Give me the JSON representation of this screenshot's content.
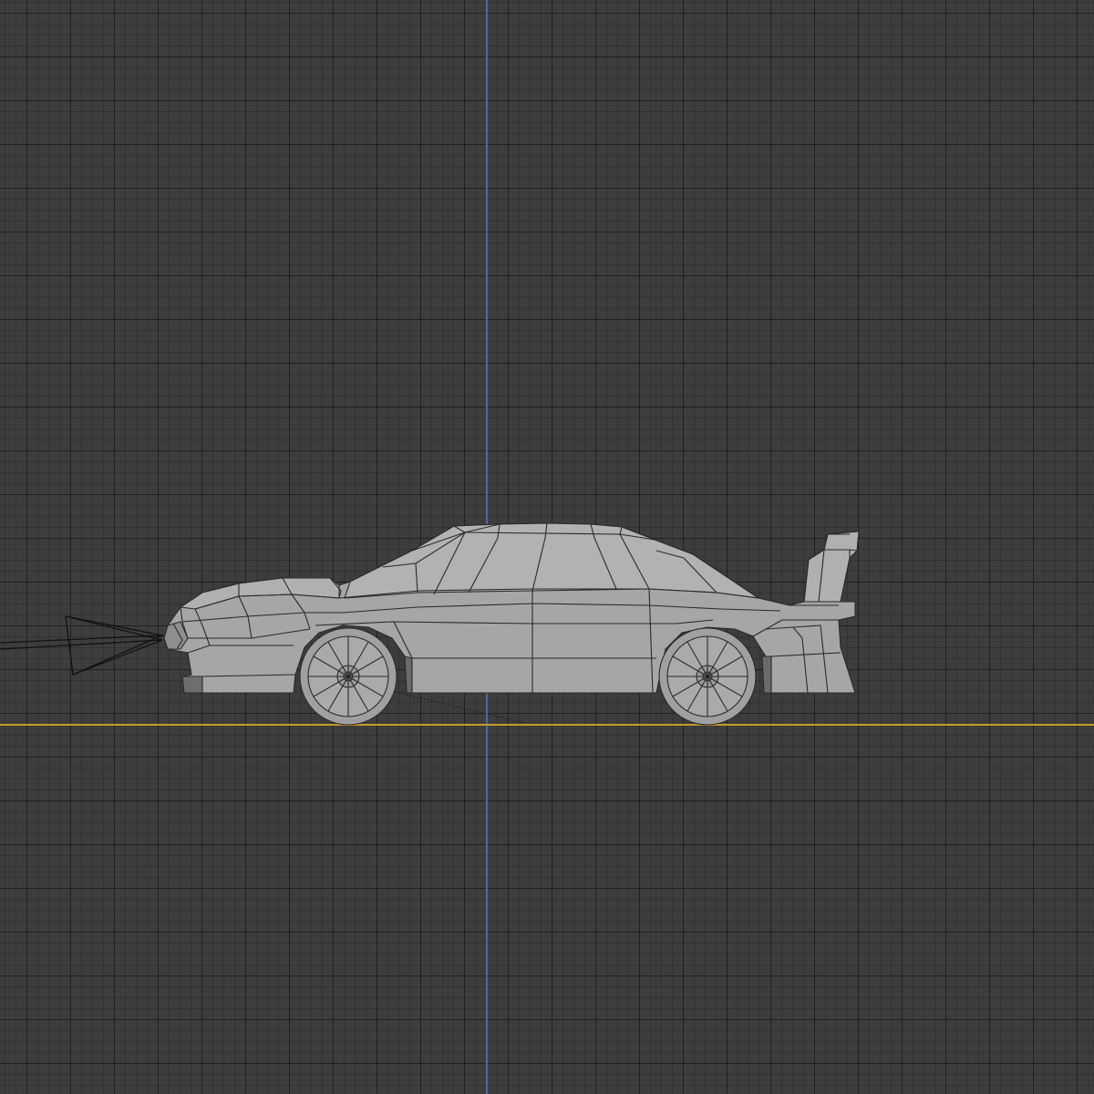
{
  "viewport": {
    "background_color": "#3d3d3d",
    "grid_color": "#2f2f2f"
  },
  "axes": {
    "z_axis_color": "#4a6aa0",
    "y_axis_color": "#c79a2a"
  },
  "model": {
    "body_color": "#a4a4a4",
    "edge_color": "#2a2a2a",
    "shadow_color": "#7a7a7a"
  },
  "camera": {
    "line_color": "#111111"
  }
}
